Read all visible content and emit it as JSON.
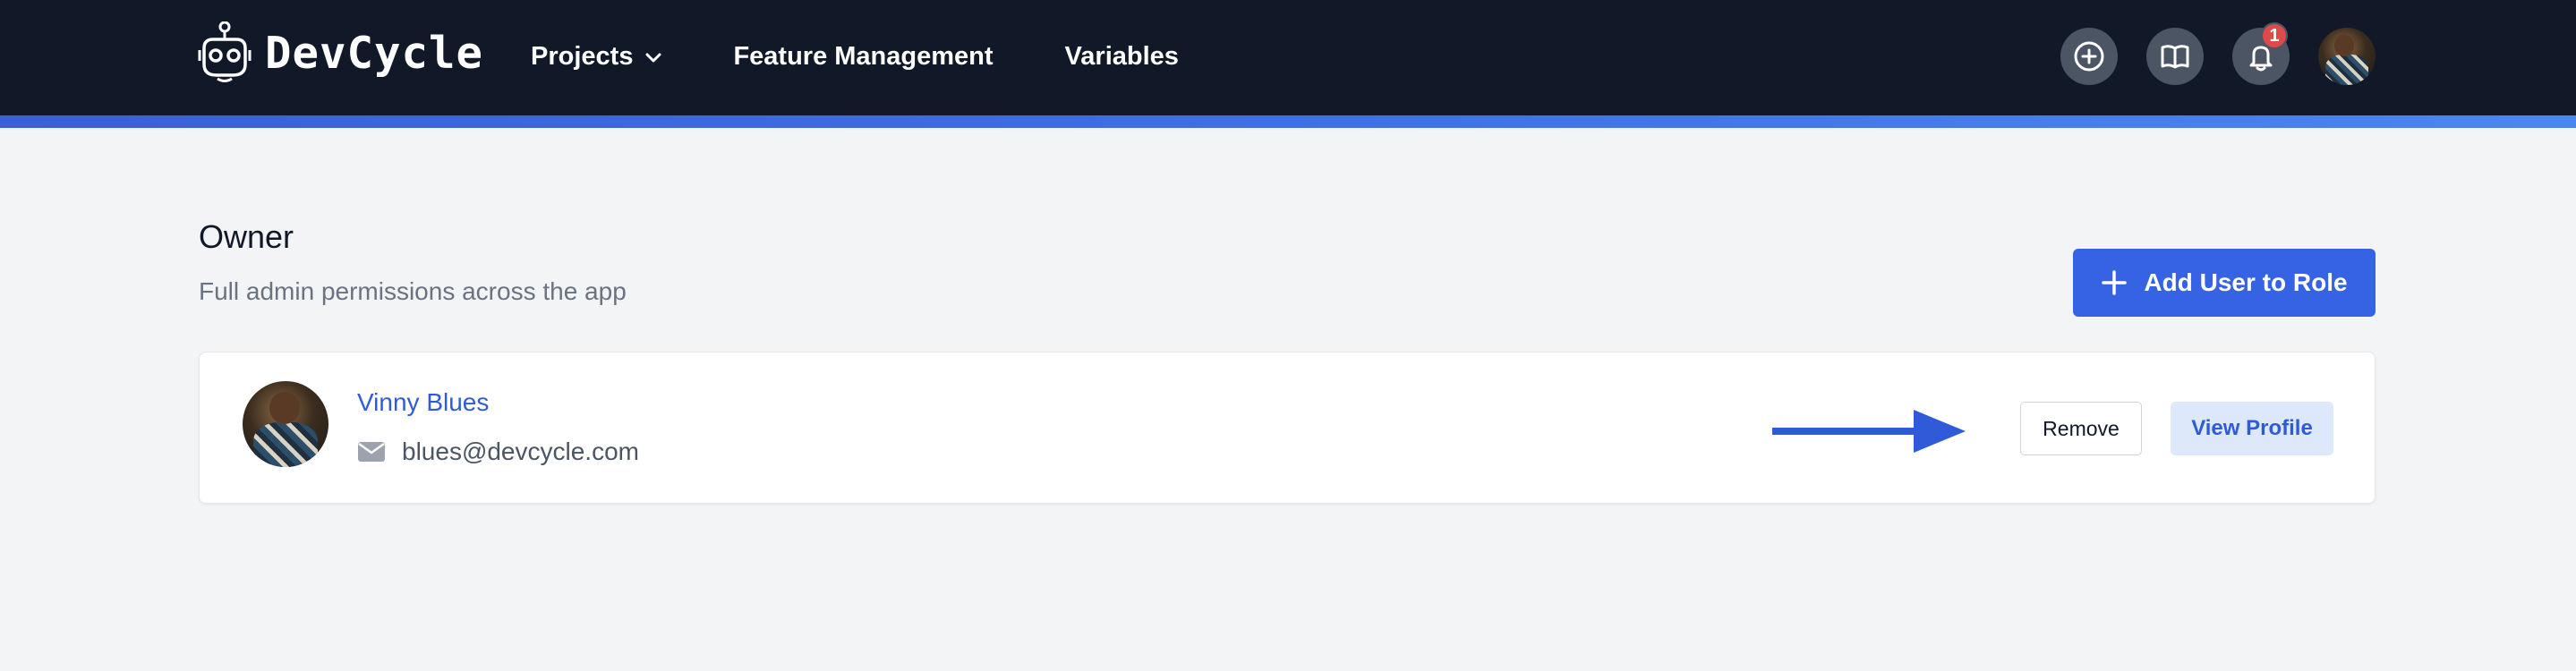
{
  "header": {
    "brand": "DevCycle",
    "nav": [
      {
        "label": "Projects",
        "icon": "chevron-down-icon"
      },
      {
        "label": "Feature Management"
      },
      {
        "label": "Variables"
      }
    ],
    "actions": [
      {
        "icon": "plus-circle-icon"
      },
      {
        "icon": "book-icon"
      },
      {
        "icon": "bell-icon",
        "badge": "1"
      },
      {
        "icon": "user-avatar"
      }
    ]
  },
  "role": {
    "title": "Owner",
    "description": "Full admin permissions across the app",
    "add_button_label": "Add User to Role"
  },
  "users": [
    {
      "name": "Vinny Blues",
      "email": "blues@devcycle.com",
      "remove_label": "Remove",
      "view_label": "View Profile"
    }
  ],
  "colors": {
    "nav_bg": "#111827",
    "accent": "#3563e4",
    "link": "#2f5bd8",
    "page_bg": "#f3f4f6"
  }
}
